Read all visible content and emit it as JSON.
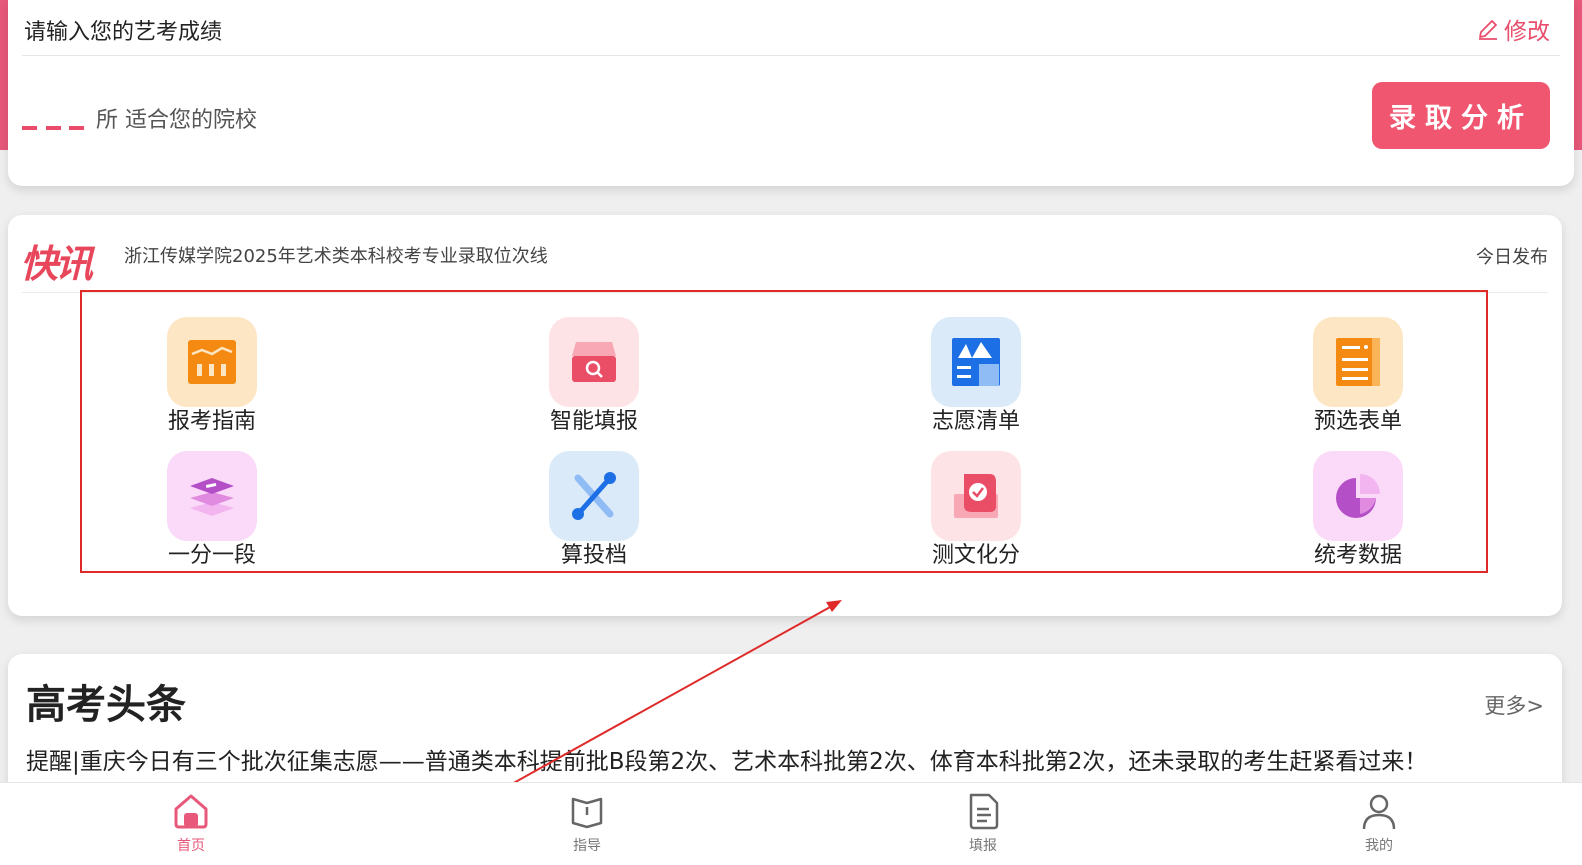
{
  "colors": {
    "accent": "#e8587a",
    "button": "#f0566f",
    "annotation": "#e02a2a"
  },
  "score_card": {
    "prompt": "请输入您的艺考成绩",
    "edit_label": "修改",
    "suitable_schools": "所 适合您的院校",
    "analysis_button": "录取分析"
  },
  "news": {
    "logo": "快讯",
    "headline": "浙江传媒学院2025年艺术类本科校考专业录取位次线",
    "date": "今日发布"
  },
  "features": [
    {
      "label": "报考指南",
      "icon": "guide-chart-icon"
    },
    {
      "label": "智能填报",
      "icon": "smart-fill-search-icon"
    },
    {
      "label": "志愿清单",
      "icon": "wishlist-icon"
    },
    {
      "label": "预选表单",
      "icon": "preselect-form-icon"
    },
    {
      "label": "一分一段",
      "icon": "score-segment-layers-icon"
    },
    {
      "label": "算投档",
      "icon": "calculate-tools-icon"
    },
    {
      "label": "测文化分",
      "icon": "culture-score-shield-icon"
    },
    {
      "label": "统考数据",
      "icon": "statistics-pie-icon"
    }
  ],
  "headlines": {
    "title": "高考头条",
    "more": "更多>",
    "item": "提醒|重庆今日有三个批次征集志愿——普通类本科提前批B段第2次、艺术本科批第2次、体育本科批第2次，还未录取的考生赶紧看过来！"
  },
  "nav": [
    {
      "label": "首页",
      "icon": "home-icon",
      "active": true
    },
    {
      "label": "指导",
      "icon": "book-icon",
      "active": false
    },
    {
      "label": "填报",
      "icon": "document-icon",
      "active": false
    },
    {
      "label": "我的",
      "icon": "user-icon",
      "active": false
    }
  ]
}
